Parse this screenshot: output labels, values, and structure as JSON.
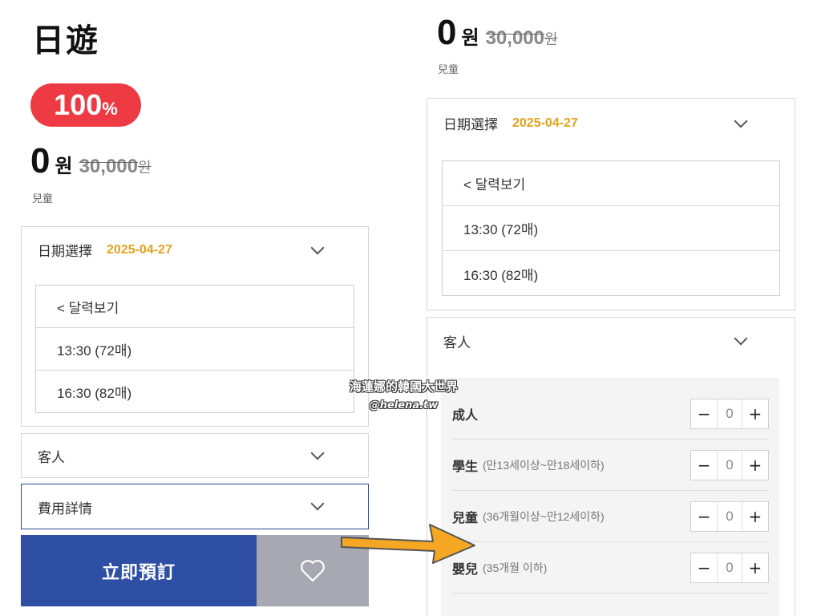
{
  "left": {
    "title": "日遊",
    "discount": {
      "number": "100",
      "percent": "%"
    },
    "price": {
      "amount": "0",
      "unit": "원",
      "original": "30,000",
      "original_unit": "원"
    },
    "category": "兒童",
    "date_section": {
      "label": "日期選擇",
      "value": "2025-04-27",
      "options": [
        "< 달력보기",
        "13:30 (72매)",
        "16:30 (82매)"
      ]
    },
    "guests_section": {
      "label": "客人"
    },
    "fee_section": {
      "label": "費用詳情"
    },
    "book_button": "立即預訂",
    "like_icon": "heart-icon"
  },
  "right": {
    "price": {
      "amount": "0",
      "unit": "원",
      "original": "30,000",
      "original_unit": "원"
    },
    "category": "兒童",
    "date_section": {
      "label": "日期選擇",
      "value": "2025-04-27",
      "options": [
        "< 달력보기",
        "13:30 (72매)",
        "16:30 (82매)"
      ]
    },
    "guests_section": {
      "label": "客人",
      "rows": [
        {
          "name": "成人",
          "note": "",
          "count": "0"
        },
        {
          "name": "學生",
          "note": "(만13세이상~만18세이하)",
          "count": "0"
        },
        {
          "name": "兒童",
          "note": "(36개월이상~만12세이하)",
          "count": "0"
        },
        {
          "name": "嬰兒",
          "note": "(35개월 이하)",
          "count": "0"
        }
      ],
      "minus": "−",
      "plus": "+"
    }
  },
  "watermark": {
    "line1": "海蓮娜的韓國大世界",
    "line2": "@helena.tw"
  },
  "colors": {
    "accent_red": "#ee3b43",
    "brand_blue": "#2e4fa3",
    "date_gold": "#e5a21d",
    "arrow_orange": "#f5a623"
  }
}
